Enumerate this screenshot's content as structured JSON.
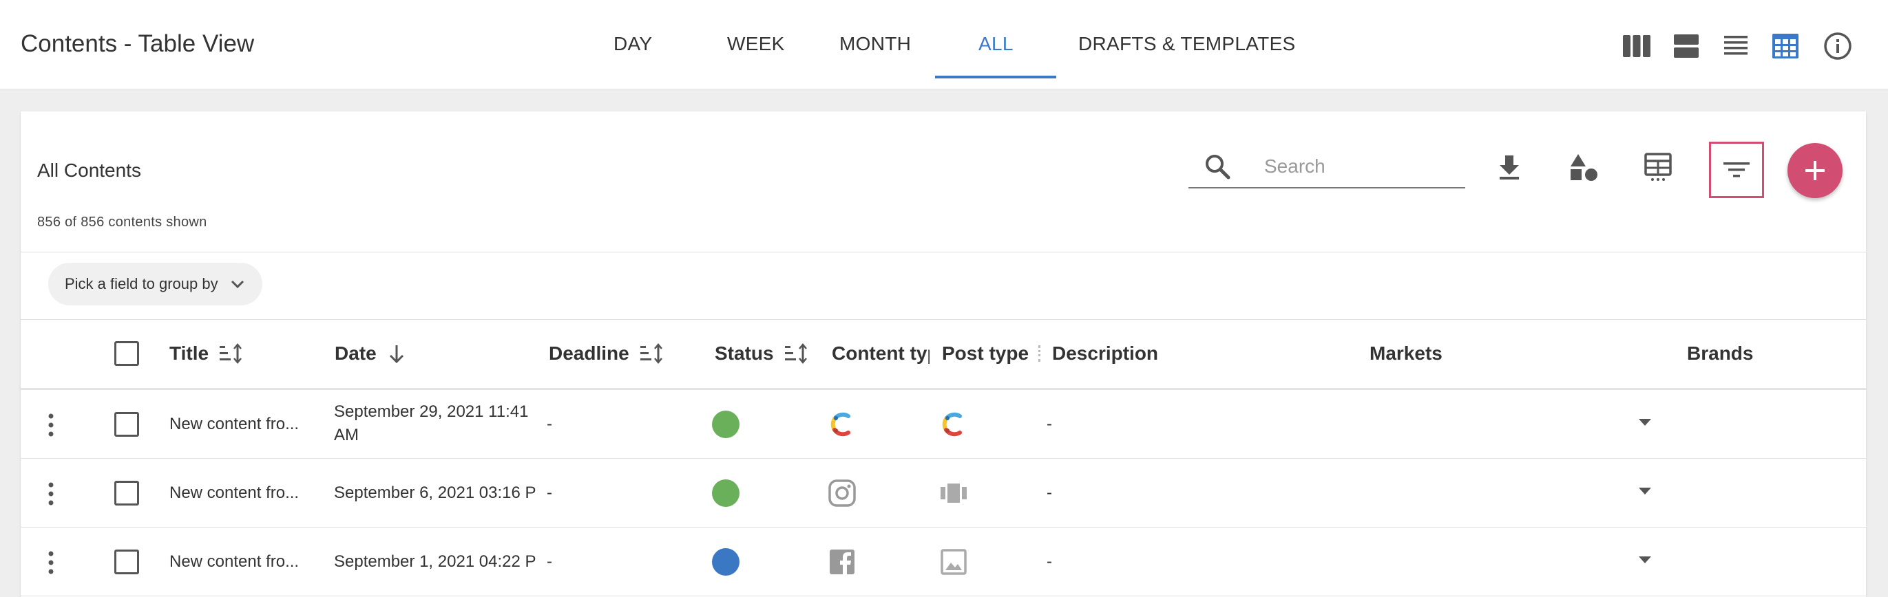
{
  "header": {
    "title": "Contents - Table View",
    "tabs": [
      {
        "label": "DAY"
      },
      {
        "label": "WEEK"
      },
      {
        "label": "MONTH"
      },
      {
        "label": "ALL",
        "active": true
      },
      {
        "label": "DRAFTS & TEMPLATES"
      }
    ],
    "view_icons": [
      "columns-view-icon",
      "rows-view-icon",
      "list-view-icon",
      "table-view-icon",
      "info-icon"
    ]
  },
  "panel": {
    "title": "All Contents",
    "count_text": "856 of 856 contents shown",
    "search": {
      "placeholder": "Search",
      "value": ""
    },
    "tools": [
      "download-icon",
      "shapes-icon",
      "table-settings-icon",
      "filter-icon",
      "add-icon"
    ],
    "group_by_label": "Pick a field to group by"
  },
  "table": {
    "columns": [
      "Title",
      "Date",
      "Deadline",
      "Status",
      "Content typ",
      "Post type",
      "Description",
      "Markets",
      "Brands"
    ],
    "rows": [
      {
        "title": "New content fro...",
        "date_line1": "September 29, 2021 11:41",
        "date_line2": "AM",
        "deadline": "-",
        "status_color": "#6aaf5a",
        "content_type_icon": "contentful-logo-icon",
        "post_type_icon": "contentful-logo-icon",
        "description": "-"
      },
      {
        "title": "New content fro...",
        "date_line1": "September 6, 2021 03:16 P",
        "date_line2": "",
        "deadline": "-",
        "status_color": "#6aaf5a",
        "content_type_icon": "instagram-icon",
        "post_type_icon": "carousel-icon",
        "description": "-"
      },
      {
        "title": "New content fro...",
        "date_line1": "September 1, 2021 04:22 P",
        "date_line2": "",
        "deadline": "-",
        "status_color": "#3a78c4",
        "content_type_icon": "facebook-icon",
        "post_type_icon": "image-icon",
        "description": "-"
      }
    ]
  },
  "colors": {
    "accent": "#3b78c7",
    "primary": "#d14d72",
    "status_green": "#6aaf5a",
    "status_blue": "#3a78c4"
  }
}
